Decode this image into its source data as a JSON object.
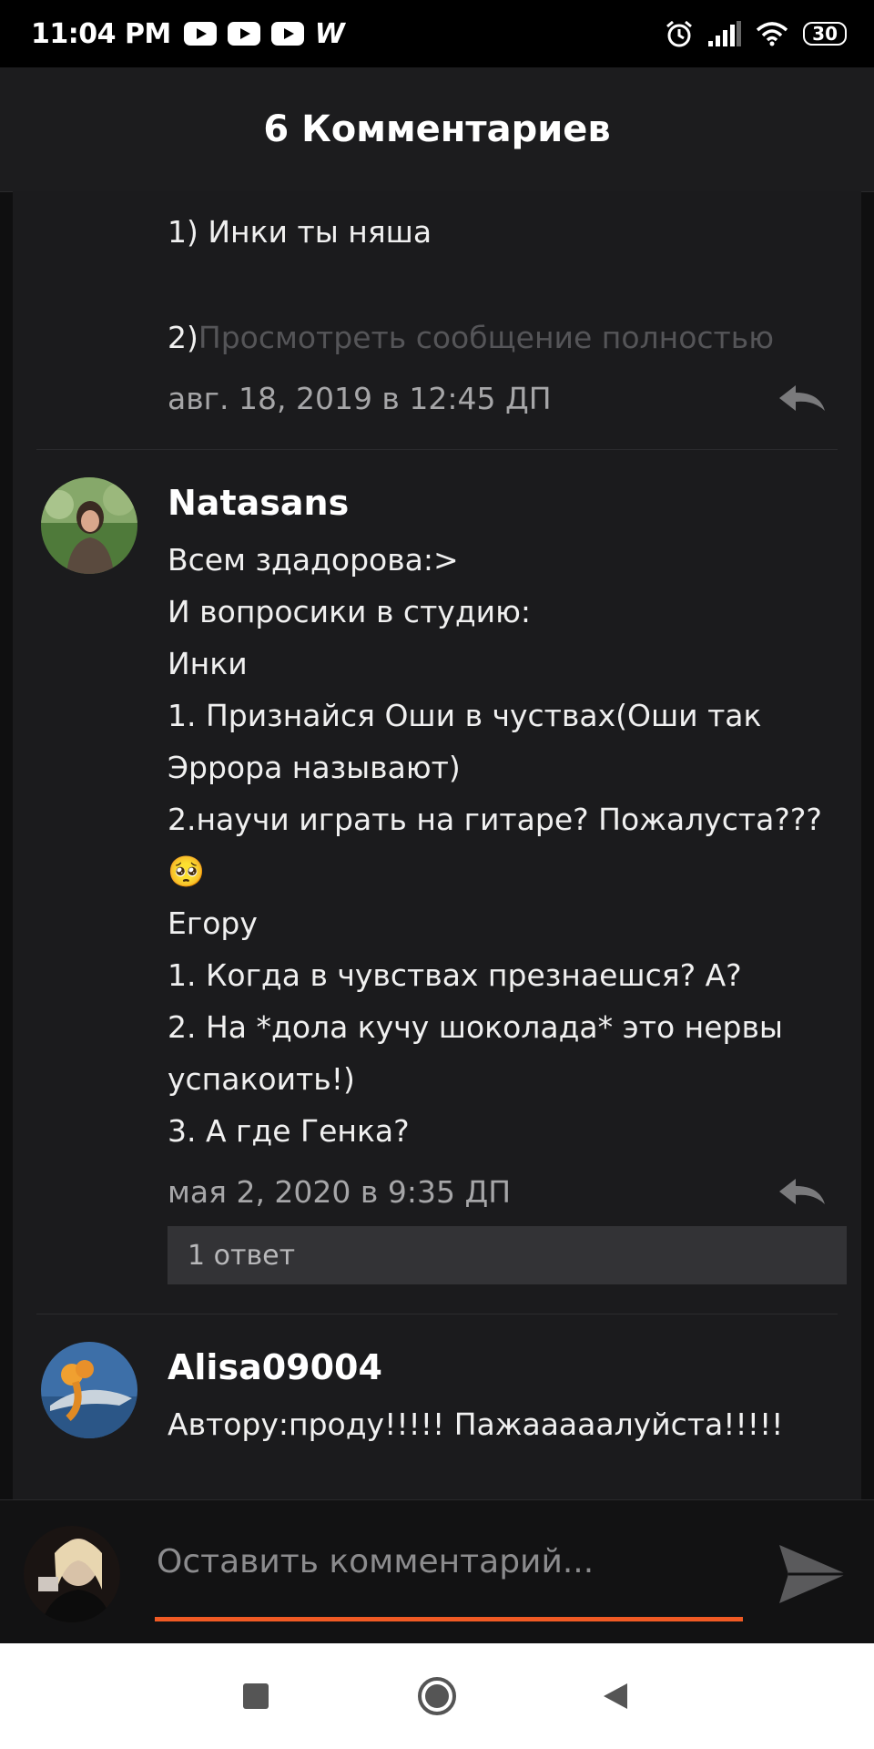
{
  "status_bar": {
    "time": "11:04 PM",
    "app_letter": "W",
    "battery": "30"
  },
  "header": {
    "title": "6 Комментариев"
  },
  "comments": [
    {
      "lines": [
        "1) Инки ты няша",
        "",
        "2)"
      ],
      "truncated_link": "Просмотреть сообщение полностью",
      "timestamp": "авг. 18, 2019 в 12:45 ДП"
    },
    {
      "username": "Natasans",
      "lines": [
        "Всем здадорова:>",
        "И вопросики в студию:",
        "Инки",
        "1. Признайся Оши в чуствах(Оши так",
        "Эррора называют)",
        "2.научи играть на гитаре? Пожалуста???",
        "🥺",
        "Егору",
        "1. Когда в чувствах презнаешся? А?",
        "2. На *дола кучу шоколада* это нервы",
        "успакоить!)",
        "3. А где Генка?"
      ],
      "timestamp": "мая 2, 2020 в 9:35 ДП",
      "replies_label": "1 ответ"
    },
    {
      "username": "Alisa09004",
      "lines": [
        "Автору:проду!!!!! Пажааааалуйста!!!!!"
      ]
    }
  ],
  "input": {
    "placeholder": "Оставить комментарий..."
  },
  "colors": {
    "accent": "#f05a24",
    "background": "#1b1b1d",
    "header": "#1c1c1e"
  }
}
